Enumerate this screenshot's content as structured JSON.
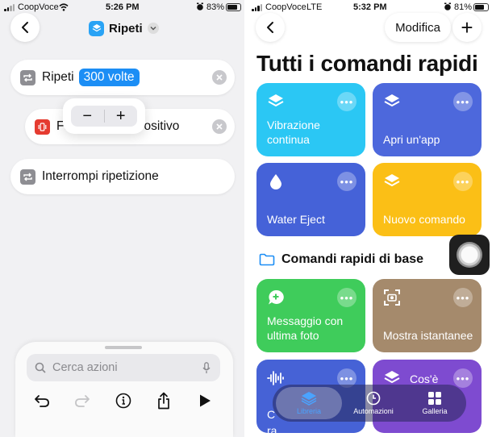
{
  "left": {
    "status": {
      "carrier": "CoopVoce",
      "time": "5:26 PM",
      "battery": "83%",
      "battery_level": 0.83
    },
    "title": "Ripeti",
    "actions": [
      {
        "label": "Ripeti",
        "token": "300 volte"
      },
      {
        "label_left": "Fa",
        "label_right": "spositivo"
      },
      {
        "label": "Interrompi ripetizione"
      }
    ],
    "stepper": {
      "minus": "−",
      "plus": "+"
    },
    "search": {
      "placeholder": "Cerca azioni"
    },
    "icons": [
      "back-icon",
      "repeat-icon",
      "vibration-icon",
      "close-icon",
      "undo-icon",
      "redo-icon",
      "info-icon",
      "share-icon",
      "play-icon",
      "mic-icon"
    ]
  },
  "right": {
    "status": {
      "carrier": "CoopVoce",
      "network": "LTE",
      "time": "5:32 PM",
      "battery": "81%",
      "battery_level": 0.81
    },
    "edit_label": "Modifica",
    "add_label": "+",
    "title": "Tutti i comandi rapidi",
    "cards": [
      {
        "label": "Vibrazione continua",
        "color": "#2bc7f4",
        "icon": "layers-icon"
      },
      {
        "label": "Apri un'app",
        "color": "#4d68dc",
        "icon": "layers-icon"
      },
      {
        "label": "Water Eject",
        "color": "#4562d8",
        "icon": "drop-icon"
      },
      {
        "label": "Nuovo comando",
        "color": "#fbbf16",
        "icon": "layers-icon"
      },
      {
        "label": "Messaggio con ultima foto",
        "color": "#3fcc5b",
        "icon": "message-icon"
      },
      {
        "label": "Mostra istantanee",
        "color": "#a58a6c",
        "icon": "screenshot-icon"
      },
      {
        "label": "C",
        "label2": "ra",
        "color": "#4662d6",
        "icon": "waveform-icon"
      },
      {
        "label": "Cos'è",
        "color": "#7e4bd0",
        "icon": "layers-icon"
      }
    ],
    "section_title": "Comandi rapidi di base",
    "tabs": [
      {
        "label": "Libreria"
      },
      {
        "label": "Automazioni"
      },
      {
        "label": "Galleria"
      }
    ],
    "more_label": "•••"
  },
  "colors": {
    "accent": "#1c8ef5",
    "card_blue": "#2bc7f4",
    "card_yellow": "#fbbf16",
    "card_green": "#3fcc5b"
  }
}
